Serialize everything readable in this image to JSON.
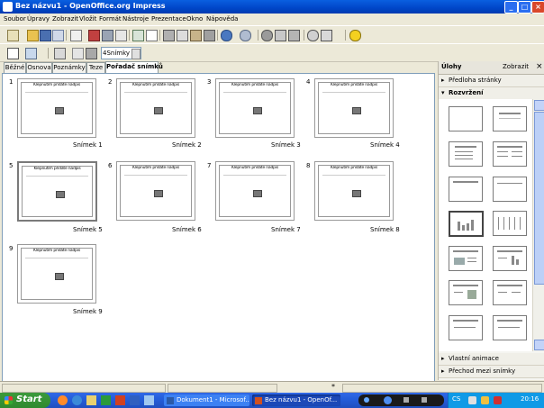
{
  "window": {
    "title": "Bez názvu1 - OpenOffice.org Impress",
    "controls": {
      "minimize": "_",
      "maximize": "□",
      "close": "×"
    }
  },
  "menu": [
    "Soubor",
    "Úpravy",
    "Zobrazit",
    "Vložit",
    "Formát",
    "Nástroje",
    "Prezentace",
    "Okno",
    "Nápověda"
  ],
  "toolbar2": {
    "slides_field": "4Snímky"
  },
  "view_tabs": [
    "Běžné",
    "Osnova",
    "Poznámky",
    "Teze",
    "Pořadač snímků"
  ],
  "slides": [
    {
      "number": "1",
      "title": "Klepnutím přidáte nadpis",
      "name": "Snímek 1"
    },
    {
      "number": "2",
      "title": "Klepnutím přidáte nadpis",
      "name": "Snímek 2"
    },
    {
      "number": "3",
      "title": "Klepnutím přidáte nadpis",
      "name": "Snímek 3"
    },
    {
      "number": "4",
      "title": "Klepnutím přidáte nadpis",
      "name": "Snímek 4"
    },
    {
      "number": "5",
      "title": "Klepnutím přidáte nadpis",
      "name": "Snímek 5"
    },
    {
      "number": "6",
      "title": "Klepnutím přidáte nadpis",
      "name": "Snímek 6"
    },
    {
      "number": "7",
      "title": "Klepnutím přidáte nadpis",
      "name": "Snímek 7"
    },
    {
      "number": "8",
      "title": "Klepnutím přidáte nadpis",
      "name": "Snímek 8"
    },
    {
      "number": "9",
      "title": "Klepnutím přidáte nadpis",
      "name": "Snímek 9"
    }
  ],
  "task_pane": {
    "title": "Úlohy",
    "view_label": "Zobrazit",
    "close": "×",
    "sections": {
      "master": "Předloha stránky",
      "layout": "Rozvržení",
      "animation": "Vlastní animace",
      "transition": "Přechod mezi snímky"
    }
  },
  "taskbar": {
    "start": "Start",
    "buttons": [
      "Dokument1 - Microsof...",
      "Bez názvu1 - OpenOf..."
    ],
    "language": "CS",
    "clock": "20:16"
  },
  "colors": {
    "titlebar": "#0050d8",
    "taskbar": "#245edb",
    "start": "#3c9a3c"
  }
}
